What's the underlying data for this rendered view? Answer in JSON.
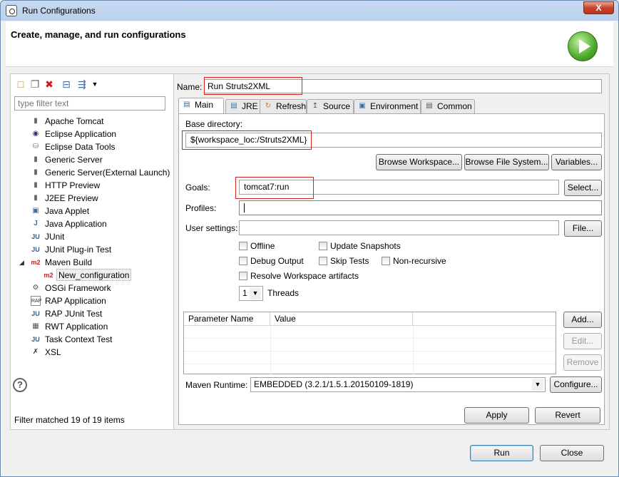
{
  "window": {
    "title": "Run Configurations",
    "close_label": "X"
  },
  "header": {
    "heading": "Create, manage, and run configurations"
  },
  "left": {
    "filter_placeholder": "type filter text",
    "tree": [
      {
        "label": "Apache Tomcat",
        "icon": "tomcat-icon"
      },
      {
        "label": "Eclipse Application",
        "icon": "eclipse-icon"
      },
      {
        "label": "Eclipse Data Tools",
        "icon": "database-icon"
      },
      {
        "label": "Generic Server",
        "icon": "server-icon"
      },
      {
        "label": "Generic Server(External Launch)",
        "icon": "server-icon"
      },
      {
        "label": "HTTP Preview",
        "icon": "server-icon"
      },
      {
        "label": "J2EE Preview",
        "icon": "server-icon"
      },
      {
        "label": "Java Applet",
        "icon": "applet-icon"
      },
      {
        "label": "Java Application",
        "icon": "java-app-icon"
      },
      {
        "label": "JUnit",
        "icon": "junit-icon"
      },
      {
        "label": "JUnit Plug-in Test",
        "icon": "junit-plugin-icon"
      },
      {
        "label": "Maven Build",
        "icon": "maven-icon"
      },
      {
        "label": "New_configuration",
        "icon": "maven-icon"
      },
      {
        "label": "OSGi Framework",
        "icon": "osgi-icon"
      },
      {
        "label": "RAP Application",
        "icon": "rap-icon"
      },
      {
        "label": "RAP JUnit Test",
        "icon": "junit-icon"
      },
      {
        "label": "RWT Application",
        "icon": "rwt-icon"
      },
      {
        "label": "Task Context Test",
        "icon": "junit-icon"
      },
      {
        "label": "XSL",
        "icon": "xsl-icon"
      }
    ],
    "status": "Filter matched 19 of 19 items"
  },
  "right": {
    "name_label": "Name:",
    "name_value": "Run Struts2XML",
    "tabs": [
      {
        "label": "Main",
        "icon": "main-tab-icon"
      },
      {
        "label": "JRE",
        "icon": "jre-icon"
      },
      {
        "label": "Refresh",
        "icon": "refresh-icon"
      },
      {
        "label": "Source",
        "icon": "source-icon"
      },
      {
        "label": "Environment",
        "icon": "environment-icon"
      },
      {
        "label": "Common",
        "icon": "common-icon"
      }
    ],
    "base_dir_label": "Base directory:",
    "base_dir_value": "${workspace_loc:/Struts2XML}",
    "browse_workspace": "Browse Workspace...",
    "browse_fs": "Browse File System...",
    "variables": "Variables...",
    "goals_label": "Goals:",
    "goals_value": "tomcat7:run",
    "select_btn": "Select...",
    "profiles_label": "Profiles:",
    "profiles_value": "",
    "user_settings_label": "User settings:",
    "user_settings_value": "",
    "file_btn": "File...",
    "offline": "Offline",
    "update_snapshots": "Update Snapshots",
    "debug_output": "Debug Output",
    "skip_tests": "Skip Tests",
    "non_recursive": "Non-recursive",
    "resolve_workspace": "Resolve Workspace artifacts",
    "threads_value": "1",
    "threads_label": "Threads",
    "param_col_name": "Parameter Name",
    "param_col_value": "Value",
    "add_btn": "Add...",
    "edit_btn": "Edit...",
    "remove_btn": "Remove",
    "maven_runtime_label": "Maven Runtime:",
    "maven_runtime_value": "EMBEDDED (3.2.1/1.5.1.20150109-1819)",
    "configure_btn": "Configure...",
    "apply_btn": "Apply",
    "revert_btn": "Revert"
  },
  "footer": {
    "run_btn": "Run",
    "close_btn": "Close",
    "help": "?"
  }
}
